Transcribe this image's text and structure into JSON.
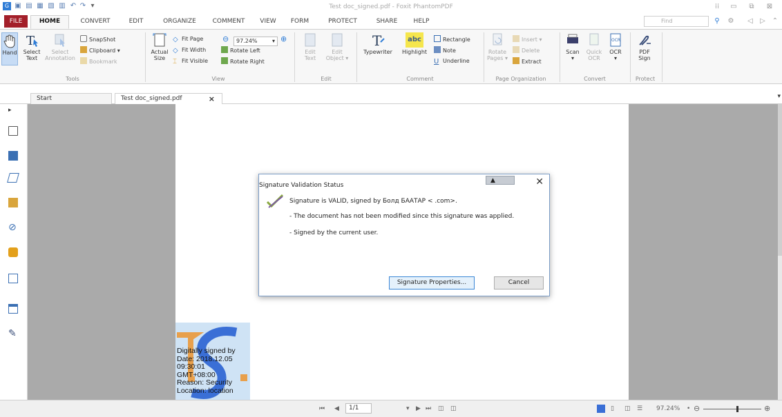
{
  "window": {
    "title": "Test doc_signed.pdf - Foxit PhantomPDF"
  },
  "menu": {
    "file": "FILE",
    "tabs": [
      "HOME",
      "CONVERT",
      "EDIT",
      "ORGANIZE",
      "COMMENT",
      "VIEW",
      "FORM",
      "PROTECT",
      "SHARE",
      "HELP"
    ],
    "find_placeholder": "Find"
  },
  "ribbon": {
    "tools": {
      "hand": "Hand",
      "select_text": [
        "Select",
        "Text"
      ],
      "select_annotation": [
        "Select",
        "Annotation"
      ],
      "snapshot": "SnapShot",
      "clipboard": "Clipboard",
      "bookmark": "Bookmark",
      "group": "Tools"
    },
    "view": {
      "actual_size": [
        "Actual",
        "Size"
      ],
      "fit_page": "Fit Page",
      "fit_width": "Fit Width",
      "fit_visible": "Fit Visible",
      "zoom": "97.24%",
      "rotate_left": "Rotate Left",
      "rotate_right": "Rotate Right",
      "group": "View"
    },
    "edit": {
      "edit_text": [
        "Edit",
        "Text"
      ],
      "edit_object": [
        "Edit",
        "Object"
      ],
      "group": "Edit"
    },
    "comment": {
      "typewriter": "Typewriter",
      "highlight": "Highlight",
      "rectangle": "Rectangle",
      "note": "Note",
      "underline": "Underline",
      "group": "Comment"
    },
    "page_org": {
      "rotate_pages": [
        "Rotate",
        "Pages"
      ],
      "insert": "Insert",
      "delete": "Delete",
      "extract": "Extract",
      "group": "Page Organization"
    },
    "convert": {
      "scan": "Scan",
      "quick_ocr": [
        "Quick",
        "OCR"
      ],
      "ocr": "OCR",
      "group": "Convert"
    },
    "protect": {
      "pdf_sign": [
        "PDF",
        "Sign"
      ],
      "group": "Protect"
    }
  },
  "doc_tabs": {
    "start": "Start",
    "active": "Test doc_signed.pdf",
    "close": "×"
  },
  "stamp": {
    "text": "Digitally signed by\nDate: 2018.12.05\n09:30:01\nGMT+08:00\nReason: Security\nLocation: location"
  },
  "dialog": {
    "title": "Signature Validation Status",
    "close": "✕",
    "valid_line": "Signature is VALID, signed by Болд БААТАР <          .com>.",
    "not_modified": "- The document has not been modified since this signature was applied.",
    "signed_by": "- Signed by the current user.",
    "properties_button": "Signature Properties...",
    "cancel_button": "Cancel"
  },
  "statusbar": {
    "page": "1/1",
    "zoom": "97.24%"
  },
  "colors": {
    "file_tab": "#a31f2a",
    "canvas": "#aaaaaa",
    "accent": "#2e7cd6"
  }
}
